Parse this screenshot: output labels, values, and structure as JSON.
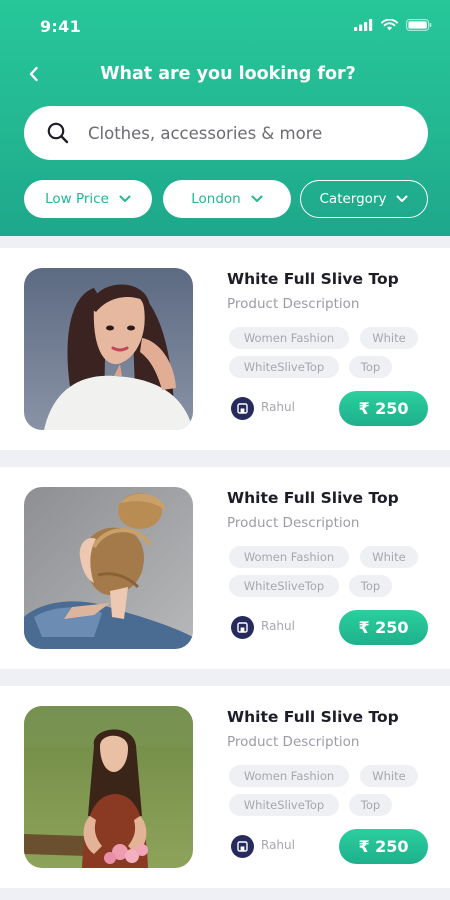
{
  "status": {
    "time": "9:41"
  },
  "header": {
    "title": "What are you looking for?",
    "search_placeholder": "Clothes, accessories & more"
  },
  "filters": [
    {
      "label": "Low Price"
    },
    {
      "label": "London"
    },
    {
      "label": "Catergory"
    }
  ],
  "products": [
    {
      "title": "White Full Slive Top",
      "description": "Product Description",
      "tags": [
        "Women Fashion",
        "White",
        "WhiteSliveTop",
        "Top"
      ],
      "seller": "Rahul",
      "price": "₹ 250"
    },
    {
      "title": "White Full Slive Top",
      "description": "Product Description",
      "tags": [
        "Women Fashion",
        "White",
        "WhiteSliveTop",
        "Top"
      ],
      "seller": "Rahul",
      "price": "₹ 250"
    },
    {
      "title": "White Full Slive Top",
      "description": "Product Description",
      "tags": [
        "Women Fashion",
        "White",
        "WhiteSliveTop",
        "Top"
      ],
      "seller": "Rahul",
      "price": "₹ 250"
    }
  ],
  "colors": {
    "accent": "#23b792",
    "seller_badge": "#262a5c",
    "tag_bg": "#eff0f3"
  }
}
